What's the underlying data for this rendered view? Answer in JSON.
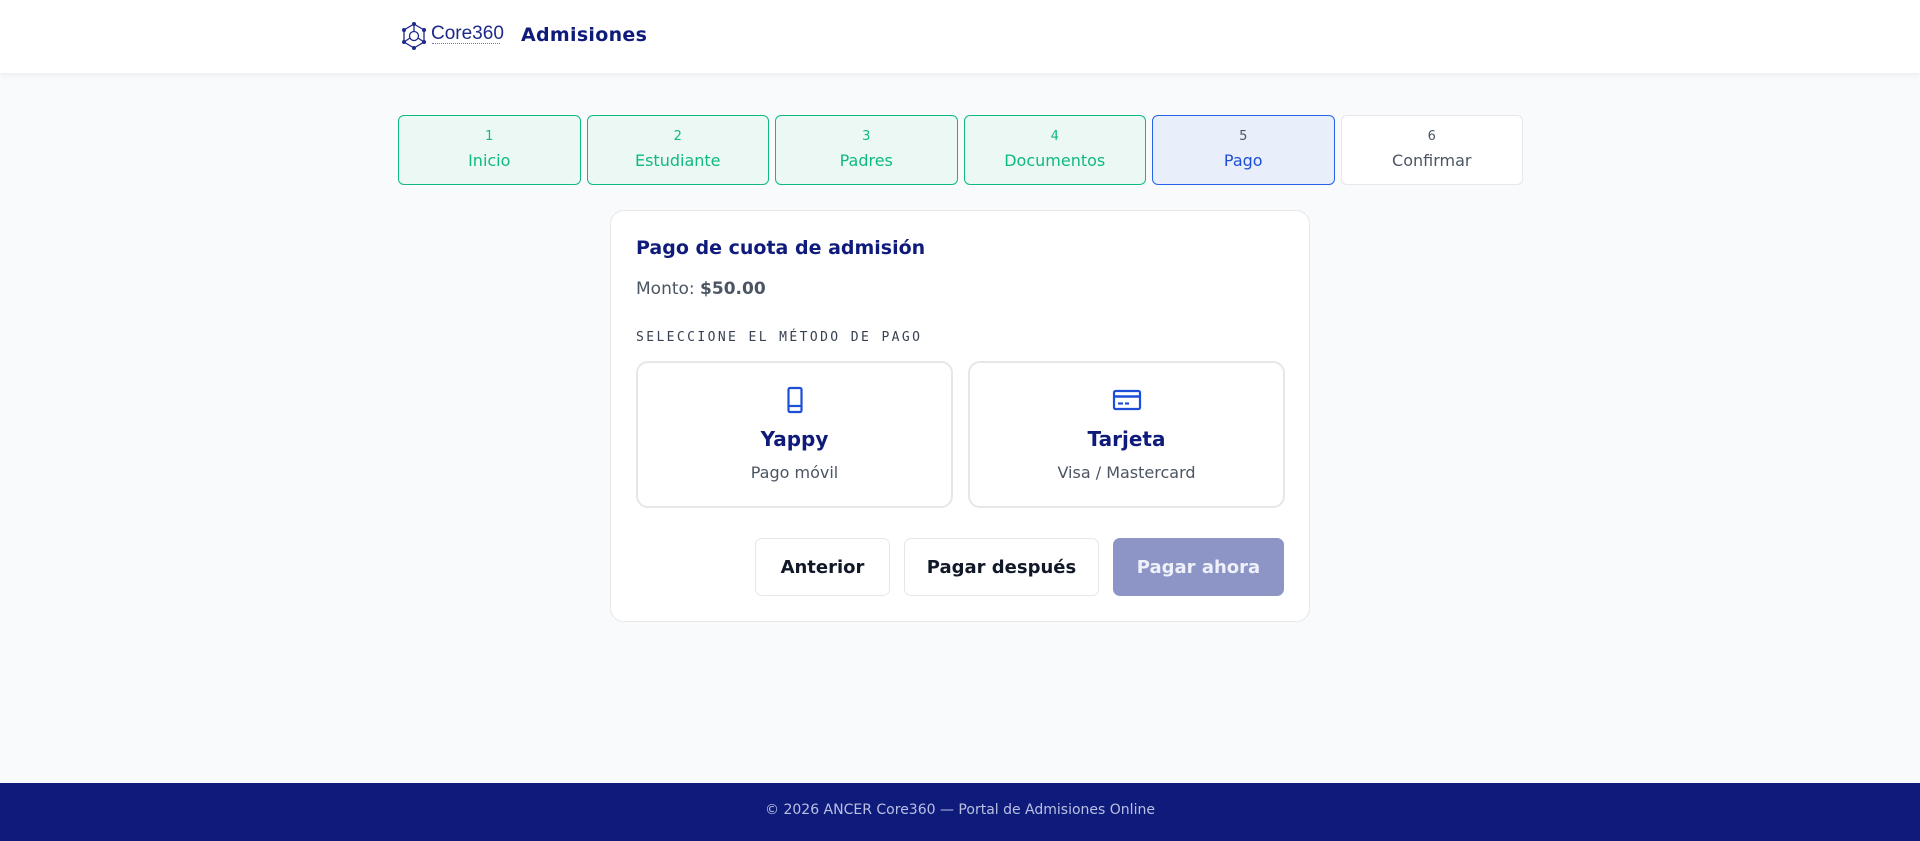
{
  "header": {
    "logo_text": "Core360",
    "title": "Admisiones"
  },
  "steps": [
    {
      "num": "1",
      "label": "Inicio",
      "state": "completed"
    },
    {
      "num": "2",
      "label": "Estudiante",
      "state": "completed"
    },
    {
      "num": "3",
      "label": "Padres",
      "state": "completed"
    },
    {
      "num": "4",
      "label": "Documentos",
      "state": "completed"
    },
    {
      "num": "5",
      "label": "Pago",
      "state": "active"
    },
    {
      "num": "6",
      "label": "Confirmar",
      "state": "pending"
    }
  ],
  "payment": {
    "title": "Pago de cuota de admisión",
    "amount_label": "Monto:",
    "amount_value": "$50.00",
    "method_label": "SELECCIONE EL MÉTODO DE PAGO",
    "methods": [
      {
        "name": "Yappy",
        "desc": "Pago móvil",
        "icon": "phone-icon"
      },
      {
        "name": "Tarjeta",
        "desc": "Visa / Mastercard",
        "icon": "credit-card-icon"
      }
    ]
  },
  "actions": {
    "prev_label": "Anterior",
    "later_label": "Pagar después",
    "pay_label": "Pagar ahora"
  },
  "footer": {
    "text": "© 2026 ANCER Core360 — Portal de Admisiones Online"
  },
  "colors": {
    "primary": "#0f1b7a",
    "success": "#10b981",
    "active": "#2563eb",
    "pay_disabled": "#8c95c5"
  }
}
